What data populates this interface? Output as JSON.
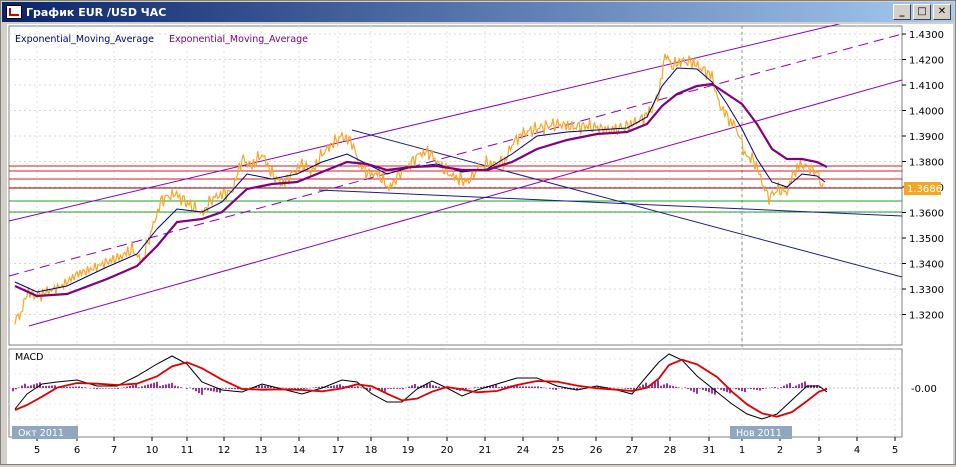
{
  "window": {
    "title": "График EUR /USD  ЧАС",
    "buttons": {
      "minimize": "_",
      "maximize": "□",
      "close": "✕"
    }
  },
  "legend": {
    "ema1": "Exponential_Moving_Average",
    "ema2": "Exponential_Moving_Average"
  },
  "price": {
    "current_label": "1.3686",
    "y_ticks": [
      "1.4300",
      "1.4200",
      "1.4100",
      "1.4000",
      "1.3900",
      "1.3800",
      "1.3700",
      "1.3600",
      "1.3500",
      "1.3400",
      "1.3300",
      "1.3200"
    ]
  },
  "macd": {
    "label": "MACD",
    "zero_label": "-0.00"
  },
  "x_axis": {
    "ticks": [
      "5",
      "6",
      "7",
      "10",
      "11",
      "12",
      "13",
      "14",
      "17",
      "18",
      "19",
      "20",
      "21",
      "24",
      "25",
      "26",
      "27",
      "28",
      "31",
      "1",
      "2",
      "3",
      "4",
      "5"
    ],
    "month_labels": [
      "Окт 2011",
      "Нов 2011"
    ]
  },
  "colors": {
    "price": "#f5a623",
    "ema_fast": "#000080",
    "ema_slow": "#800080",
    "channel": "#8b00c8",
    "trend": "#1c1c8c",
    "resistance": "#d02020",
    "support": "#20a020",
    "macd_line": "#000000",
    "signal_line": "#e00000",
    "histogram": "#800080",
    "current_badge": "#f5a623"
  }
}
